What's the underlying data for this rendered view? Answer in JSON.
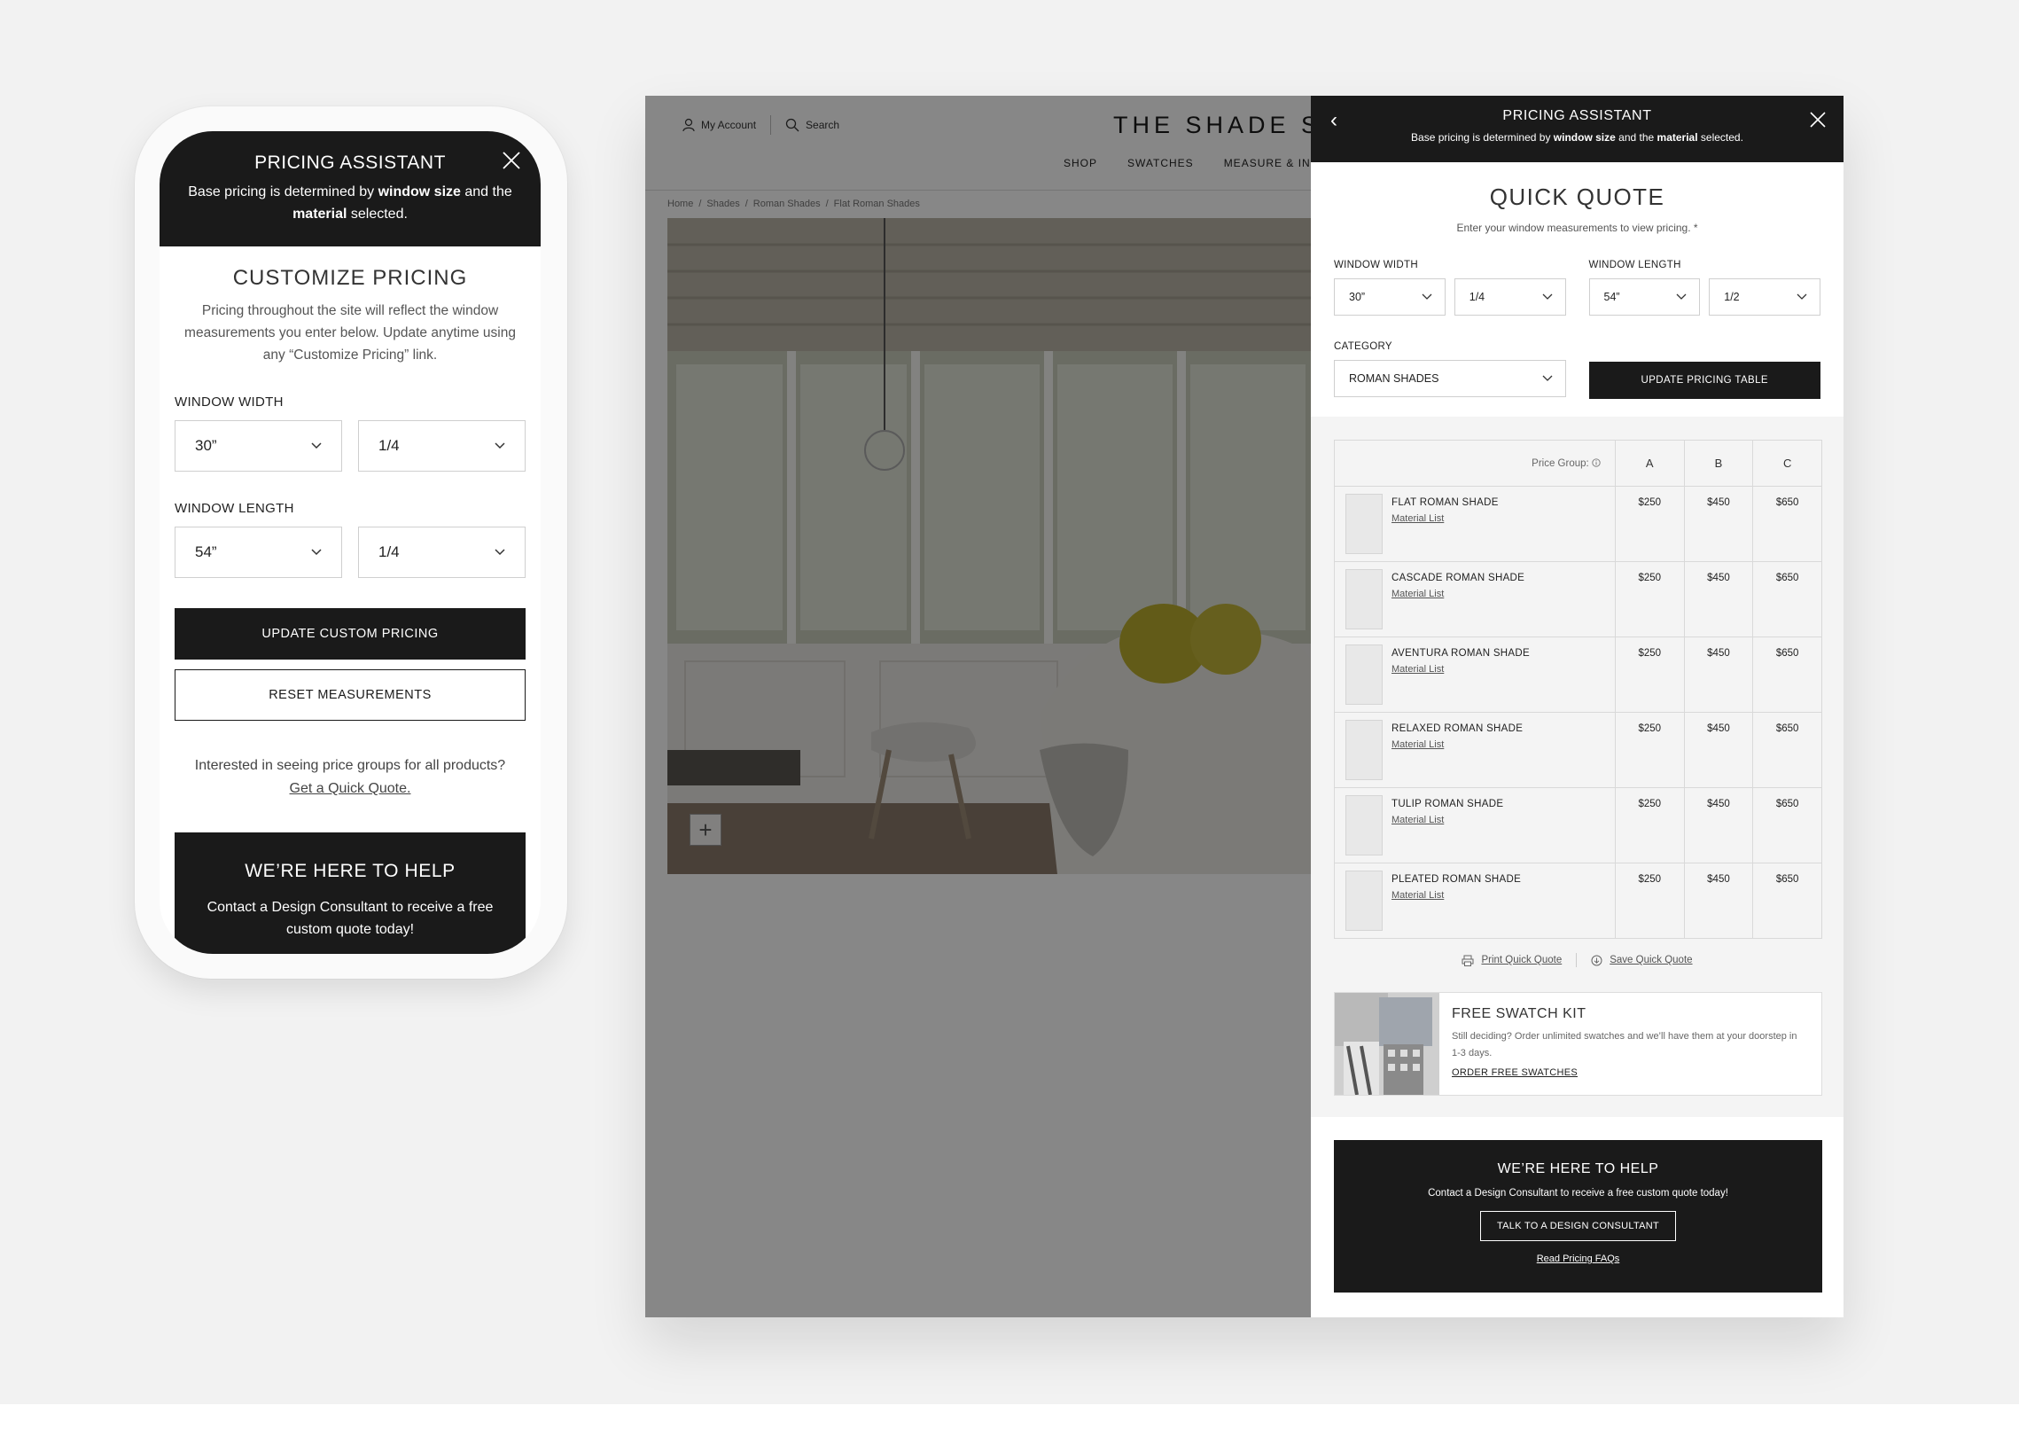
{
  "mobile": {
    "header": {
      "title": "PRICING ASSISTANT",
      "sub_pre": "Base pricing is determined by ",
      "sub_bold1": "window size",
      "sub_mid": " and the ",
      "sub_bold2": "material",
      "sub_post": " selected."
    },
    "title": "CUSTOMIZE PRICING",
    "description": "Pricing throughout the site will reflect the window measurements you enter below. Update anytime using any “Customize Pricing” link.",
    "width_label": "WINDOW WIDTH",
    "width_value": "30”",
    "width_fraction": "1/4",
    "length_label": "WINDOW LENGTH",
    "length_value": "54”",
    "length_fraction": "1/4",
    "update_button": "UPDATE CUSTOM PRICING",
    "reset_button": "RESET MEASUREMENTS",
    "interest_text": "Interested in seeing price groups for all products?",
    "quick_quote_link": "Get a Quick Quote.",
    "help": {
      "title": "WE’RE HERE TO HELP",
      "text": "Contact a Design Consultant to receive a free custom quote today!"
    }
  },
  "site": {
    "account": "My Account",
    "search": "Search",
    "logo": "THE SHADE ST",
    "nav": [
      "SHOP",
      "SWATCHES",
      "MEASURE & IN"
    ],
    "breadcrumbs": [
      "Home",
      "Shades",
      "Roman Shades",
      "Flat Roman Shades"
    ]
  },
  "panel": {
    "header": {
      "title": "PRICING ASSISTANT",
      "sub_pre": "Base pricing is determined by ",
      "sub_bold1": "window size",
      "sub_mid": " and the ",
      "sub_bold2": "material",
      "sub_post": " selected."
    },
    "quote_title": "QUICK QUOTE",
    "quote_sub": "Enter your window measurements to view pricing. *",
    "width_label": "WINDOW WIDTH",
    "width_value": "30”",
    "width_fraction": "1/4",
    "length_label": "WINDOW LENGTH",
    "length_value": "54”",
    "length_fraction": "1/2",
    "category_label": "CATEGORY",
    "category_value": "ROMAN SHADES",
    "update_button": "UPDATE PRICING TABLE",
    "price_group_label": "Price Group:",
    "columns": [
      "A",
      "B",
      "C"
    ],
    "material_link": "Material List",
    "products": [
      {
        "name": "FLAT ROMAN SHADE",
        "prices": [
          "$250",
          "$450",
          "$650"
        ]
      },
      {
        "name": "CASCADE ROMAN SHADE",
        "prices": [
          "$250",
          "$450",
          "$650"
        ]
      },
      {
        "name": "AVENTURA ROMAN SHADE",
        "prices": [
          "$250",
          "$450",
          "$650"
        ]
      },
      {
        "name": "RELAXED ROMAN SHADE",
        "prices": [
          "$250",
          "$450",
          "$650"
        ]
      },
      {
        "name": "TULIP ROMAN SHADE",
        "prices": [
          "$250",
          "$450",
          "$650"
        ]
      },
      {
        "name": "PLEATED ROMAN SHADE",
        "prices": [
          "$250",
          "$450",
          "$650"
        ]
      }
    ],
    "print_link": "Print Quick Quote",
    "save_link": "Save Quick Quote",
    "swatch": {
      "title": "FREE SWATCH KIT",
      "description": "Still deciding? Order unlimited swatches and we’ll have them at your doorstep in 1-3 days.",
      "link": "ORDER FREE SWATCHES"
    },
    "help": {
      "title": "WE’RE HERE TO HELP",
      "text": "Contact a Design Consultant to receive a free custom quote today!",
      "button": "TALK TO A DESIGN CONSULTANT",
      "link": "Read Pricing FAQs"
    }
  },
  "colors": {
    "dark": "#1a1a1a",
    "background": "#f2f2f2",
    "overlay": "rgba(0,0,0,0.47)"
  }
}
